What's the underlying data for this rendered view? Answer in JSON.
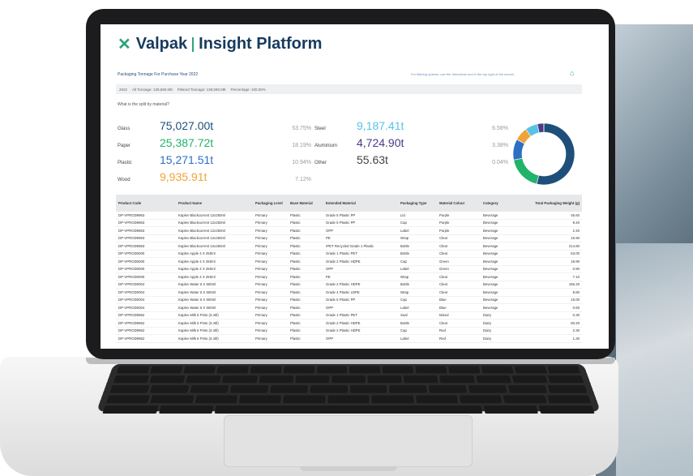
{
  "brand": {
    "name": "Valpak",
    "product": "Insight Platform",
    "icon": "valpak-x-logo"
  },
  "header": {
    "title": "Packaging Tonnage For Purchase Year 2022",
    "filter_hint": "For filtering options, use the Selections tool in the top right of the screen",
    "home_icon": "home-icon"
  },
  "summary": {
    "year": "2022",
    "all_tonnage": "All Tonnage: 139,590.08t",
    "filtered_tonnage": "Filtered Tonnage: 139,590.08t",
    "percentage": "Percentage: 100.00%"
  },
  "question": "What is the split by material?",
  "materials": [
    {
      "label": "Glass",
      "value": "75,027.00t",
      "pct": "53.75%",
      "color": "#1e4f7a"
    },
    {
      "label": "Paper",
      "value": "25,387.72t",
      "pct": "18.19%",
      "color": "#22b36b"
    },
    {
      "label": "Plastic",
      "value": "15,271.51t",
      "pct": "10.94%",
      "color": "#2e6fc4"
    },
    {
      "label": "Wood",
      "value": "9,935.91t",
      "pct": "7.12%",
      "color": "#f0a33a"
    },
    {
      "label": "Steel",
      "value": "9,187.41t",
      "pct": "6.58%",
      "color": "#58c2e8"
    },
    {
      "label": "Aluminium",
      "value": "4,724.90t",
      "pct": "3.38%",
      "color": "#4a3a86"
    },
    {
      "label": "Other",
      "value": "55.63t",
      "pct": "0.04%",
      "color": "#444444"
    }
  ],
  "table": {
    "headers": [
      "Product Code",
      "Product Name",
      "Packaging Level",
      "Base Material",
      "Extended Material",
      "Packaging Type",
      "Material Colour",
      "Category",
      "Total Packaging Weight (g)"
    ],
    "rows": [
      [
        "DP-VPROD9963",
        "Kaplev Blackcurrent 12x250ml",
        "Primary",
        "Plastic",
        "Grade 5 Plastic PP",
        "Lid",
        "Purple",
        "Beverage",
        "45.60"
      ],
      [
        "DP-VPROD9963",
        "Kaplev Blackcurrent 12x250ml",
        "Primary",
        "Plastic",
        "Grade 5 Plastic PP",
        "Cap",
        "Purple",
        "Beverage",
        "8.40"
      ],
      [
        "DP-VPROD9963",
        "Kaplev Blackcurrent 12x250ml",
        "Primary",
        "Plastic",
        "OPP",
        "Label",
        "Purple",
        "Beverage",
        "2.40"
      ],
      [
        "DP-VPROD9963",
        "Kaplev Blackcurrent 12x250ml",
        "Primary",
        "Plastic",
        "PE",
        "Wrap",
        "Clear",
        "Beverage",
        "15.90"
      ],
      [
        "DP-VPROD9963",
        "Kaplev Blackcurrent 12x250ml",
        "Primary",
        "Plastic",
        "rPET Recycled Grade 1 Plastic",
        "Bottle",
        "Clear",
        "Beverage",
        "214.80"
      ],
      [
        "DP-VPROD0000",
        "Kaplev Apple 4 X 250ml",
        "Primary",
        "Plastic",
        "Grade 1 Plastic PET",
        "Bottle",
        "Clear",
        "Beverage",
        "63.00"
      ],
      [
        "DP-VPROD0000",
        "Kaplev Apple 4 X 250ml",
        "Primary",
        "Plastic",
        "Grade 2 Plastic HDPE",
        "Cap",
        "Green",
        "Beverage",
        "18.90"
      ],
      [
        "DP-VPROD0000",
        "Kaplev Apple 4 X 250ml",
        "Primary",
        "Plastic",
        "OPP",
        "Label",
        "Green",
        "Beverage",
        "0.90"
      ],
      [
        "DP-VPROD0000",
        "Kaplev Apple 4 X 250ml",
        "Primary",
        "Plastic",
        "PE",
        "Wrap",
        "Clear",
        "Beverage",
        "7.10"
      ],
      [
        "DP-VPROD0004",
        "Kaplev Water 6 X 500ml",
        "Primary",
        "Plastic",
        "Grade 2 Plastic HDPE",
        "Bottle",
        "Clear",
        "Beverage",
        "155.20"
      ],
      [
        "DP-VPROD0004",
        "Kaplev Water 6 X 500ml",
        "Primary",
        "Plastic",
        "Grade 4 Plastic LDPE",
        "Wrap",
        "Clear",
        "Beverage",
        "8.80"
      ],
      [
        "DP-VPROD0004",
        "Kaplev Water 6 X 500ml",
        "Primary",
        "Plastic",
        "Grade 5 Plastic PP",
        "Cap",
        "Blue",
        "Beverage",
        "15.00"
      ],
      [
        "DP-VPROD0004",
        "Kaplev Water 6 X 500ml",
        "Primary",
        "Plastic",
        "OPP",
        "Label",
        "Blue",
        "Beverage",
        "0.60"
      ],
      [
        "DP-VPROD9962",
        "Kaplev Milk 6 Pints (3.40l)",
        "Primary",
        "Plastic",
        "Grade 1 Plastic PET",
        "Seal",
        "Mixed",
        "Dairy",
        "0.30"
      ],
      [
        "DP-VPROD9962",
        "Kaplev Milk 6 Pints (3.40l)",
        "Primary",
        "Plastic",
        "Grade 2 Plastic HDPE",
        "Bottle",
        "Clear",
        "Dairy",
        "60.20"
      ],
      [
        "DP-VPROD9962",
        "Kaplev Milk 6 Pints (3.40l)",
        "Primary",
        "Plastic",
        "Grade 2 Plastic HDPE",
        "Cap",
        "Red",
        "Dairy",
        "2.30"
      ],
      [
        "DP-VPROD9962",
        "Kaplev Milk 6 Pints (3.40l)",
        "Primary",
        "Plastic",
        "OPP",
        "Label",
        "Red",
        "Dairy",
        "1.30"
      ]
    ]
  }
}
